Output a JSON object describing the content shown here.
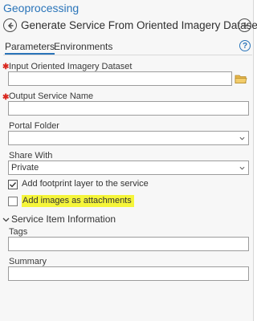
{
  "pane": {
    "title": "Geoprocessing"
  },
  "tool": {
    "title": "Generate Service From Oriented Imagery Dataset"
  },
  "tabs": [
    {
      "label": "Parameters",
      "active": true
    },
    {
      "label": "Environments",
      "active": false
    }
  ],
  "colors": {
    "accent": "#2a74b9",
    "required": "#d9281f",
    "highlight": "#f5f53a"
  },
  "params": {
    "input_dataset": {
      "label": "Input Oriented Imagery Dataset",
      "value": "",
      "required": true
    },
    "output_name": {
      "label": "Output Service Name",
      "value": "",
      "required": true
    },
    "portal_folder": {
      "label": "Portal Folder",
      "value": ""
    },
    "share_with": {
      "label": "Share With",
      "value": "Private"
    },
    "add_footprint": {
      "label": "Add footprint layer to the service",
      "checked": true
    },
    "add_attachments": {
      "label": "Add images as attachments",
      "checked": false
    }
  },
  "service_info": {
    "title": "Service Item Information",
    "tags": {
      "label": "Tags",
      "value": ""
    },
    "summary": {
      "label": "Summary",
      "value": ""
    }
  },
  "icons": {
    "back": "back-arrow-icon",
    "add": "plus-icon",
    "help": "help-icon",
    "folder": "folder-icon",
    "dropdown": "chevron-down-icon",
    "collapse": "chevron-down-icon",
    "check": "checkmark-icon"
  }
}
